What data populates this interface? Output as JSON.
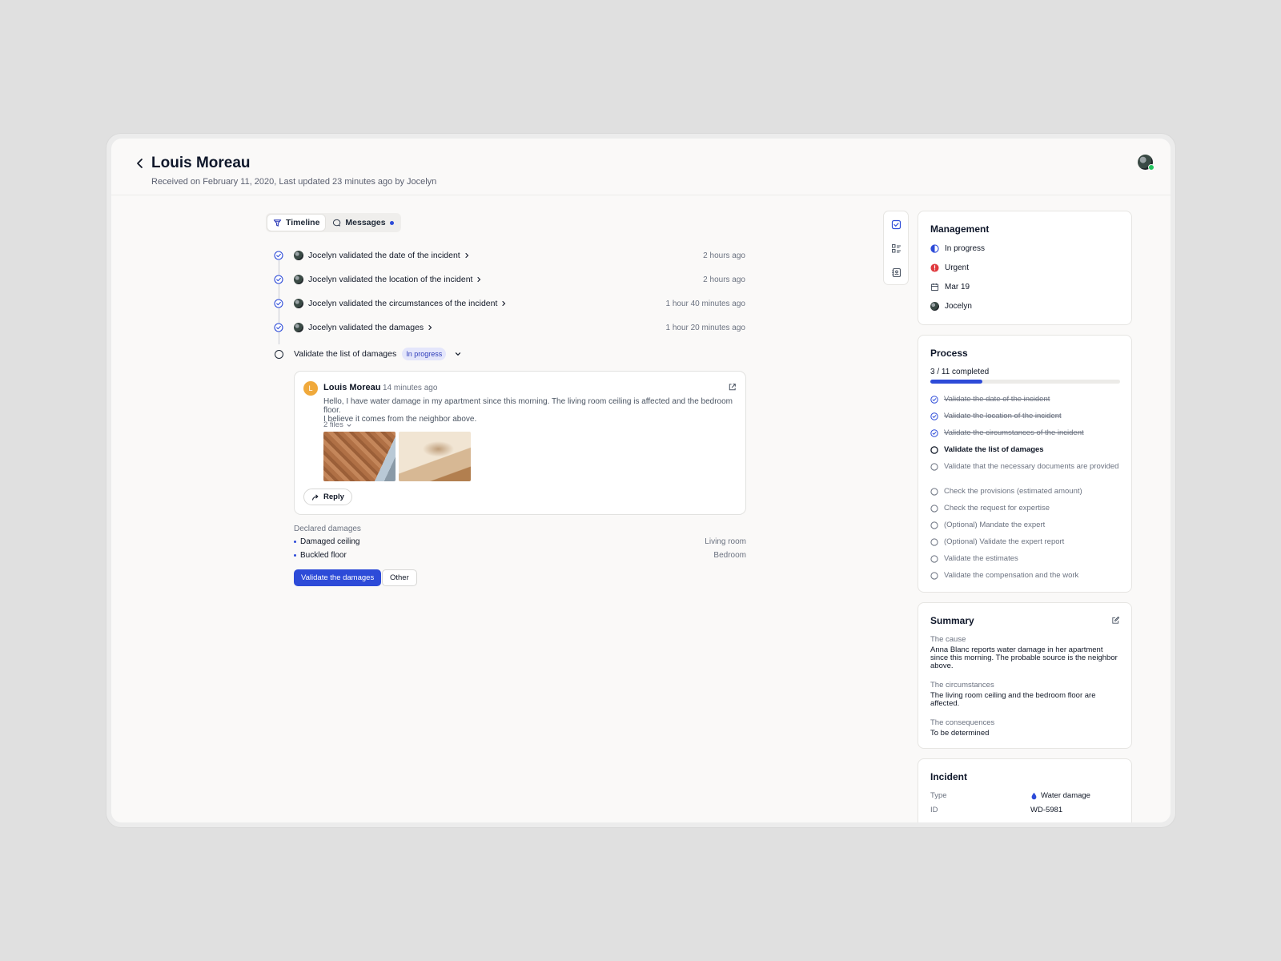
{
  "header": {
    "title": "Louis Moreau",
    "subtitle": "Received on February 11, 2020, Last updated 23 minutes ago by Jocelyn"
  },
  "tabs": [
    {
      "label": "Timeline",
      "icon": "funnel-icon",
      "active": true
    },
    {
      "label": "Messages",
      "icon": "chat-bubble-icon",
      "active": false,
      "unread": true
    }
  ],
  "timeline": {
    "events": [
      {
        "text": "Jocelyn validated the date of the incident",
        "time": "2 hours ago"
      },
      {
        "text": "Jocelyn validated the location of the incident",
        "time": "2 hours ago"
      },
      {
        "text": "Jocelyn validated the circumstances of the incident",
        "time": "1 hour 40 minutes ago"
      },
      {
        "text": "Jocelyn validated the damages",
        "time": "1 hour 20 minutes ago"
      }
    ],
    "current": {
      "text": "Validate the list of damages",
      "status": "In progress"
    }
  },
  "message": {
    "avatar_initial": "L",
    "author": "Louis Moreau",
    "time": "14 minutes ago",
    "body_line1": "Hello, I have water damage in my apartment since this morning. The living room ceiling is affected and the bedroom floor.",
    "body_line2": "I believe it comes from the neighbor above.",
    "files_label": "2 files",
    "reply_label": "Reply"
  },
  "declared": {
    "title": "Declared damages",
    "items": [
      {
        "name": "Damaged ceiling",
        "location": "Living room"
      },
      {
        "name": "Buckled floor",
        "location": "Bedroom"
      }
    ],
    "primary_action": "Validate the damages",
    "secondary_action": "Other"
  },
  "management": {
    "title": "Management",
    "status": "In progress",
    "priority": "Urgent",
    "date": "Mar 19",
    "assignee": "Jocelyn"
  },
  "process": {
    "title": "Process",
    "completed_label": "3 / 11 completed",
    "completed": 3,
    "total": 11,
    "steps": [
      {
        "label": "Validate the date of the incident",
        "state": "done"
      },
      {
        "label": "Validate the location of the incident",
        "state": "done"
      },
      {
        "label": "Validate the circumstances of the incident",
        "state": "done"
      },
      {
        "label": "Validate the list of damages",
        "state": "current"
      },
      {
        "label": "Validate that the necessary documents are provided",
        "state": "todo"
      },
      {
        "label": "Check the provisions (estimated amount)",
        "state": "todo"
      },
      {
        "label": "Check the request for expertise",
        "state": "todo"
      },
      {
        "label": "(Optional) Mandate the expert",
        "state": "todo"
      },
      {
        "label": "(Optional) Validate the expert report",
        "state": "todo"
      },
      {
        "label": "Validate the estimates",
        "state": "todo"
      },
      {
        "label": "Validate the compensation and the work",
        "state": "todo"
      }
    ]
  },
  "summary": {
    "title": "Summary",
    "cause_label": "The cause",
    "cause_text": "Anna Blanc reports water damage in her apartment since this morning. The probable source is the neighbor above.",
    "circumstances_label": "The circumstances",
    "circumstances_text": "The living room ceiling and the bedroom floor are affected.",
    "consequences_label": "The consequences",
    "consequences_text": "To be determined"
  },
  "incident": {
    "title": "Incident",
    "type_label": "Type",
    "type_value": "Water damage",
    "id_label": "ID",
    "id_value": "WD-5981"
  },
  "colors": {
    "accent": "#2d4bd8",
    "urgent": "#e0393e",
    "online": "#22c55e",
    "sender_avatar": "#f0a93b"
  }
}
